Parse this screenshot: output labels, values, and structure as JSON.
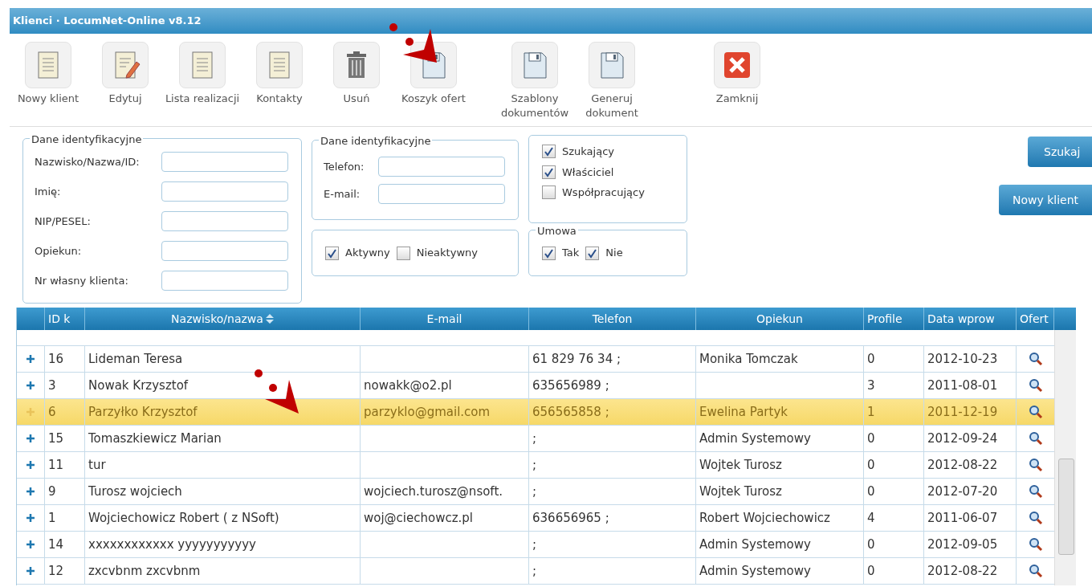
{
  "window": {
    "title": "Klienci · LocumNet-Online v8.12"
  },
  "toolbar": [
    {
      "label": "Nowy klient",
      "kind": "doc"
    },
    {
      "label": "Edytuj",
      "kind": "edit"
    },
    {
      "label": "Lista realizacji",
      "kind": "doc"
    },
    {
      "label": "Kontakty",
      "kind": "doc"
    },
    {
      "label": "Usuń",
      "kind": "trash"
    },
    {
      "label": "Koszyk ofert",
      "kind": "disk"
    },
    {
      "label": "Szablony dokumentów",
      "kind": "disk"
    },
    {
      "label": "Generuj dokument",
      "kind": "disk"
    },
    {
      "label": "Zamknij",
      "kind": "close"
    }
  ],
  "filters": {
    "group1": {
      "legend": "Dane identyfikacyjne",
      "fields": [
        "Nazwisko/Nazwa/ID:",
        "Imię:",
        "NIP/PESEL:",
        "Opiekun:",
        "Nr własny klienta:"
      ]
    },
    "group2": {
      "legend": "Dane identyfikacyjne",
      "fields": [
        "Telefon:",
        "E-mail:"
      ]
    },
    "status": [
      {
        "label": "Aktywny",
        "checked": true
      },
      {
        "label": "Nieaktywny",
        "checked": false
      }
    ],
    "roles": [
      {
        "label": "Szukający",
        "checked": true
      },
      {
        "label": "Właściciel",
        "checked": true
      },
      {
        "label": "Współpracujący",
        "checked": false
      }
    ],
    "contract": {
      "legend": "Umowa",
      "options": [
        {
          "label": "Tak",
          "checked": true
        },
        {
          "label": "Nie",
          "checked": true
        }
      ]
    }
  },
  "buttons": [
    "Szukaj",
    "Nowy klient"
  ],
  "table": {
    "columns": [
      "ID k",
      "Nazwisko/nazwa",
      "E-mail",
      "Telefon",
      "Opiekun",
      "Profile",
      "Data wprow",
      "Ofert"
    ],
    "rows": [
      {
        "id": "16",
        "name": "Lideman Teresa",
        "email": "",
        "phone": "61 829 76 34 ;",
        "keeper": "Monika Tomczak",
        "profile": "0",
        "date": "2012-10-23",
        "selected": false
      },
      {
        "id": "3",
        "name": "Nowak Krzysztof",
        "email": "nowakk@o2.pl",
        "phone": "635656989 ;",
        "keeper": "",
        "profile": "3",
        "date": "2011-08-01",
        "selected": false
      },
      {
        "id": "6",
        "name": "Parzyłko Krzysztof",
        "email": "parzyklo@gmail.com",
        "phone": "656565858 ;",
        "keeper": "Ewelina Partyk",
        "profile": "1",
        "date": "2011-12-19",
        "selected": true
      },
      {
        "id": "15",
        "name": "Tomaszkiewicz Marian",
        "email": "",
        "phone": ";",
        "keeper": "Admin Systemowy",
        "profile": "0",
        "date": "2012-09-24",
        "selected": false
      },
      {
        "id": "11",
        "name": "tur",
        "email": "",
        "phone": ";",
        "keeper": "Wojtek Turosz",
        "profile": "0",
        "date": "2012-08-22",
        "selected": false
      },
      {
        "id": "9",
        "name": "Turosz wojciech",
        "email": "wojciech.turosz@nsoft.",
        "phone": ";",
        "keeper": "Wojtek Turosz",
        "profile": "0",
        "date": "2012-07-20",
        "selected": false
      },
      {
        "id": "1",
        "name": "Wojciechowicz Robert ( z NSoft)",
        "email": "woj@ciechowcz.pl",
        "phone": "636656965 ;",
        "keeper": "Robert Wojciechowicz",
        "profile": "4",
        "date": "2011-06-07",
        "selected": false
      },
      {
        "id": "14",
        "name": "xxxxxxxxxxxx yyyyyyyyyyy",
        "email": "",
        "phone": ";",
        "keeper": "Admin Systemowy",
        "profile": "0",
        "date": "2012-09-05",
        "selected": false
      },
      {
        "id": "12",
        "name": "zxcvbnm zxcvbnm",
        "email": "",
        "phone": ";",
        "keeper": "Admin Systemowy",
        "profile": "0",
        "date": "2012-08-22",
        "selected": false
      }
    ]
  }
}
